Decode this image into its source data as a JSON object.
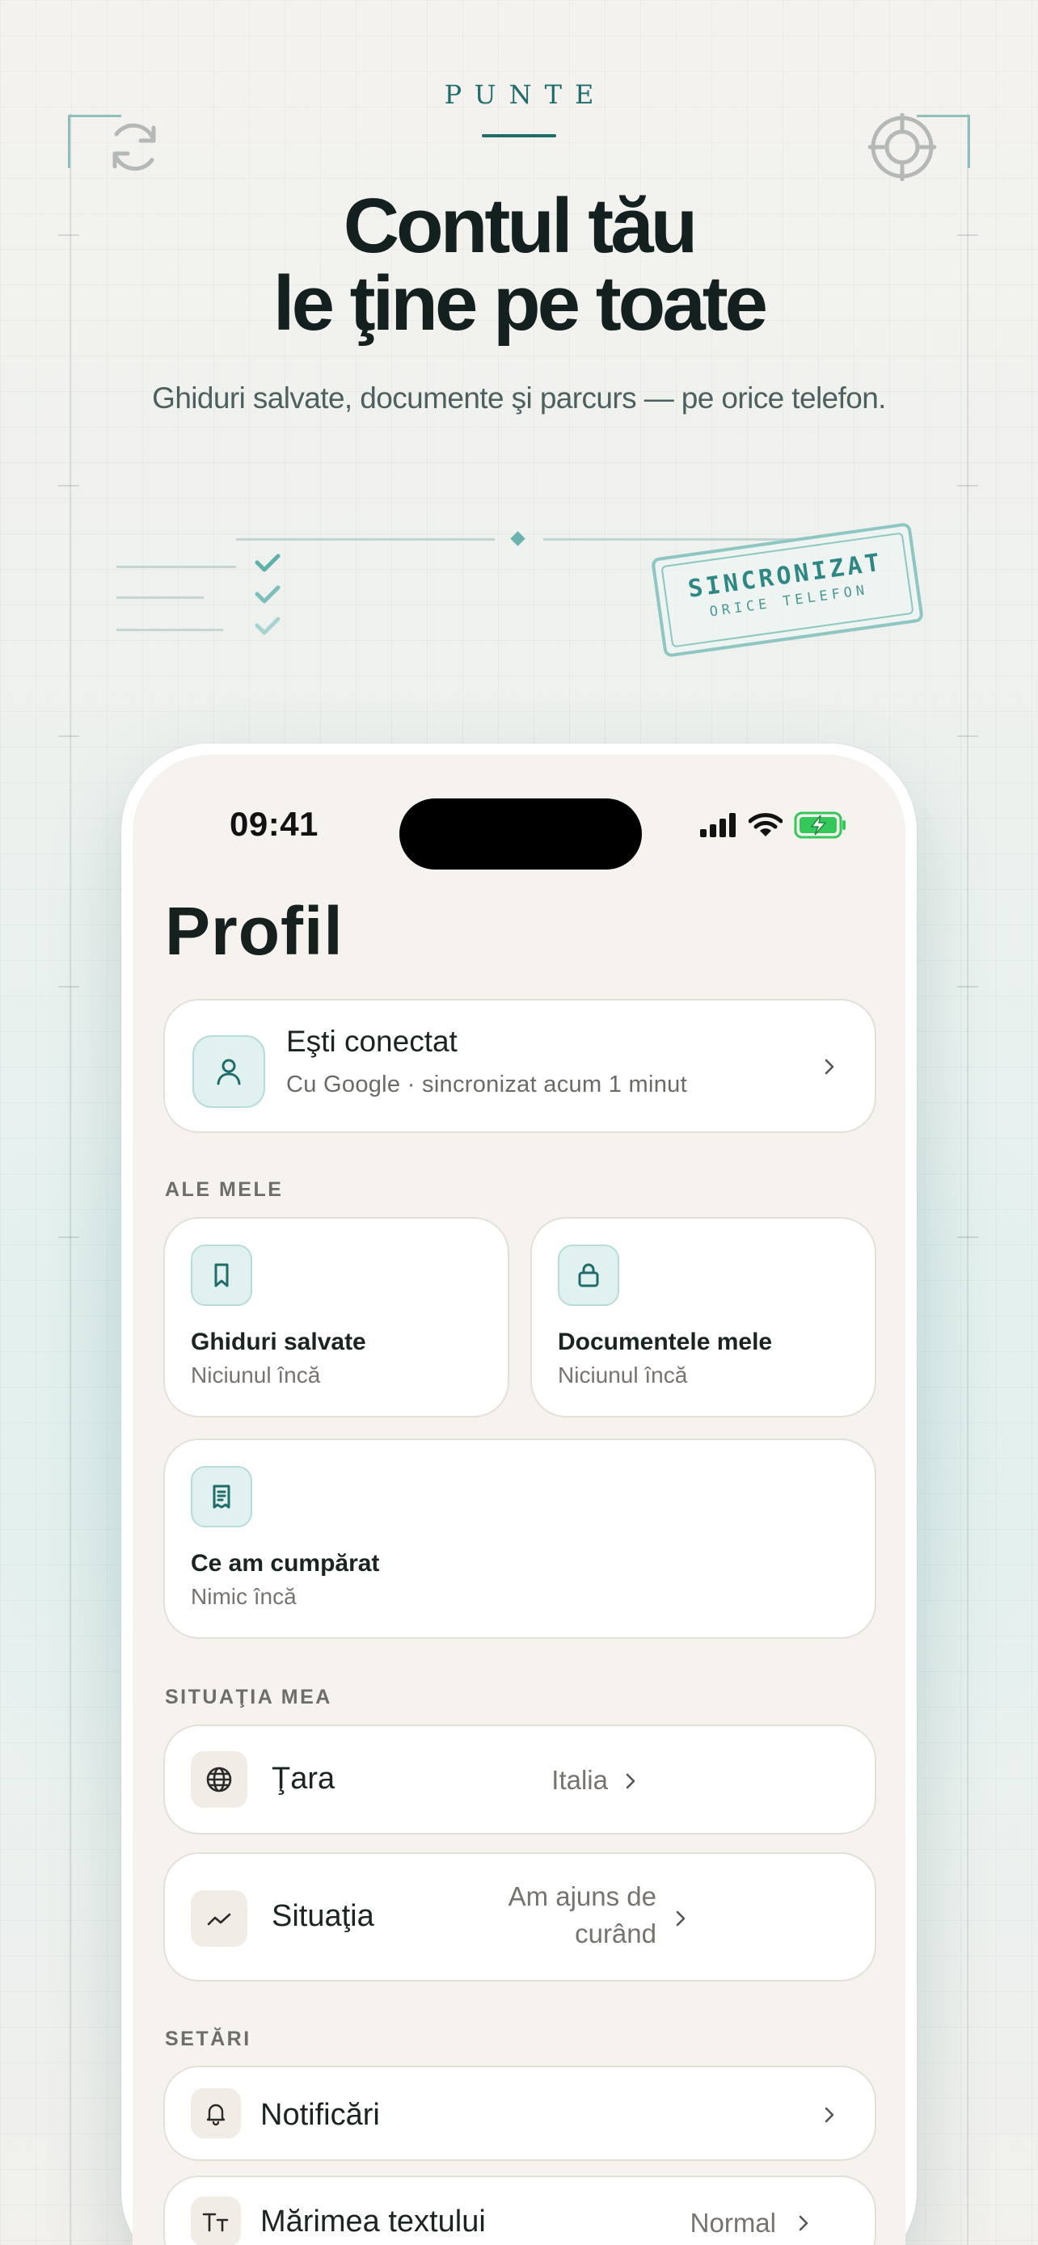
{
  "brand": {
    "name": "PUNTE"
  },
  "hero": {
    "headline_line1": "Contul tău",
    "headline_line2": "le ţine pe toate",
    "subhead": "Ghiduri salvate, documente şi parcurs — pe orice telefon."
  },
  "stamp": {
    "line1": "SINCRONIZAT",
    "line2": "ORICE TELEFON"
  },
  "status_bar": {
    "time": "09:41"
  },
  "profile": {
    "title": "Profil",
    "account": {
      "title": "Eşti conectat",
      "subtitle": "Cu Google · sincronizat acum 1 minut",
      "icon": "person-icon"
    },
    "mine": {
      "label": "ALE MELE",
      "tiles": [
        {
          "title": "Ghiduri salvate",
          "subtitle": "Niciunul încă",
          "icon": "bookmark-icon"
        },
        {
          "title": "Documentele mele",
          "subtitle": "Niciunul încă",
          "icon": "lock-icon"
        },
        {
          "title": "Ce am cumpărat",
          "subtitle": "Nimic încă",
          "icon": "receipt-icon"
        }
      ]
    },
    "situation": {
      "label": "SITUAŢIA MEA",
      "rows": [
        {
          "label": "Ţara",
          "value": "Italia",
          "icon": "globe-icon"
        },
        {
          "label": "Situaţia",
          "value_line1": "Am ajuns de",
          "value_line2": "curând",
          "icon": "trend-icon"
        }
      ]
    },
    "settings": {
      "label": "SETĂRI",
      "rows": [
        {
          "label": "Notificări",
          "value": "",
          "icon": "bell-icon"
        },
        {
          "label": "Mărimea textului",
          "value": "Normal",
          "icon": "text-size-icon"
        }
      ]
    }
  },
  "colors": {
    "accent": "#1f6c6a",
    "accent_light": "#e0f1f0",
    "screen_bg": "#f6f3ee",
    "text_dark": "#13201f"
  }
}
